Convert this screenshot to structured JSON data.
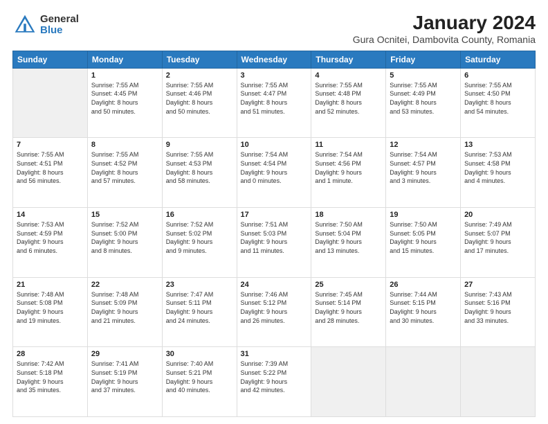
{
  "logo": {
    "general": "General",
    "blue": "Blue"
  },
  "title": "January 2024",
  "subtitle": "Gura Ocnitei, Dambovita County, Romania",
  "days_header": [
    "Sunday",
    "Monday",
    "Tuesday",
    "Wednesday",
    "Thursday",
    "Friday",
    "Saturday"
  ],
  "weeks": [
    [
      {
        "day": "",
        "info": ""
      },
      {
        "day": "1",
        "info": "Sunrise: 7:55 AM\nSunset: 4:45 PM\nDaylight: 8 hours\nand 50 minutes."
      },
      {
        "day": "2",
        "info": "Sunrise: 7:55 AM\nSunset: 4:46 PM\nDaylight: 8 hours\nand 50 minutes."
      },
      {
        "day": "3",
        "info": "Sunrise: 7:55 AM\nSunset: 4:47 PM\nDaylight: 8 hours\nand 51 minutes."
      },
      {
        "day": "4",
        "info": "Sunrise: 7:55 AM\nSunset: 4:48 PM\nDaylight: 8 hours\nand 52 minutes."
      },
      {
        "day": "5",
        "info": "Sunrise: 7:55 AM\nSunset: 4:49 PM\nDaylight: 8 hours\nand 53 minutes."
      },
      {
        "day": "6",
        "info": "Sunrise: 7:55 AM\nSunset: 4:50 PM\nDaylight: 8 hours\nand 54 minutes."
      }
    ],
    [
      {
        "day": "7",
        "info": "Sunrise: 7:55 AM\nSunset: 4:51 PM\nDaylight: 8 hours\nand 56 minutes."
      },
      {
        "day": "8",
        "info": "Sunrise: 7:55 AM\nSunset: 4:52 PM\nDaylight: 8 hours\nand 57 minutes."
      },
      {
        "day": "9",
        "info": "Sunrise: 7:55 AM\nSunset: 4:53 PM\nDaylight: 8 hours\nand 58 minutes."
      },
      {
        "day": "10",
        "info": "Sunrise: 7:54 AM\nSunset: 4:54 PM\nDaylight: 9 hours\nand 0 minutes."
      },
      {
        "day": "11",
        "info": "Sunrise: 7:54 AM\nSunset: 4:56 PM\nDaylight: 9 hours\nand 1 minute."
      },
      {
        "day": "12",
        "info": "Sunrise: 7:54 AM\nSunset: 4:57 PM\nDaylight: 9 hours\nand 3 minutes."
      },
      {
        "day": "13",
        "info": "Sunrise: 7:53 AM\nSunset: 4:58 PM\nDaylight: 9 hours\nand 4 minutes."
      }
    ],
    [
      {
        "day": "14",
        "info": "Sunrise: 7:53 AM\nSunset: 4:59 PM\nDaylight: 9 hours\nand 6 minutes."
      },
      {
        "day": "15",
        "info": "Sunrise: 7:52 AM\nSunset: 5:00 PM\nDaylight: 9 hours\nand 8 minutes."
      },
      {
        "day": "16",
        "info": "Sunrise: 7:52 AM\nSunset: 5:02 PM\nDaylight: 9 hours\nand 9 minutes."
      },
      {
        "day": "17",
        "info": "Sunrise: 7:51 AM\nSunset: 5:03 PM\nDaylight: 9 hours\nand 11 minutes."
      },
      {
        "day": "18",
        "info": "Sunrise: 7:50 AM\nSunset: 5:04 PM\nDaylight: 9 hours\nand 13 minutes."
      },
      {
        "day": "19",
        "info": "Sunrise: 7:50 AM\nSunset: 5:05 PM\nDaylight: 9 hours\nand 15 minutes."
      },
      {
        "day": "20",
        "info": "Sunrise: 7:49 AM\nSunset: 5:07 PM\nDaylight: 9 hours\nand 17 minutes."
      }
    ],
    [
      {
        "day": "21",
        "info": "Sunrise: 7:48 AM\nSunset: 5:08 PM\nDaylight: 9 hours\nand 19 minutes."
      },
      {
        "day": "22",
        "info": "Sunrise: 7:48 AM\nSunset: 5:09 PM\nDaylight: 9 hours\nand 21 minutes."
      },
      {
        "day": "23",
        "info": "Sunrise: 7:47 AM\nSunset: 5:11 PM\nDaylight: 9 hours\nand 24 minutes."
      },
      {
        "day": "24",
        "info": "Sunrise: 7:46 AM\nSunset: 5:12 PM\nDaylight: 9 hours\nand 26 minutes."
      },
      {
        "day": "25",
        "info": "Sunrise: 7:45 AM\nSunset: 5:14 PM\nDaylight: 9 hours\nand 28 minutes."
      },
      {
        "day": "26",
        "info": "Sunrise: 7:44 AM\nSunset: 5:15 PM\nDaylight: 9 hours\nand 30 minutes."
      },
      {
        "day": "27",
        "info": "Sunrise: 7:43 AM\nSunset: 5:16 PM\nDaylight: 9 hours\nand 33 minutes."
      }
    ],
    [
      {
        "day": "28",
        "info": "Sunrise: 7:42 AM\nSunset: 5:18 PM\nDaylight: 9 hours\nand 35 minutes."
      },
      {
        "day": "29",
        "info": "Sunrise: 7:41 AM\nSunset: 5:19 PM\nDaylight: 9 hours\nand 37 minutes."
      },
      {
        "day": "30",
        "info": "Sunrise: 7:40 AM\nSunset: 5:21 PM\nDaylight: 9 hours\nand 40 minutes."
      },
      {
        "day": "31",
        "info": "Sunrise: 7:39 AM\nSunset: 5:22 PM\nDaylight: 9 hours\nand 42 minutes."
      },
      {
        "day": "",
        "info": ""
      },
      {
        "day": "",
        "info": ""
      },
      {
        "day": "",
        "info": ""
      }
    ]
  ]
}
